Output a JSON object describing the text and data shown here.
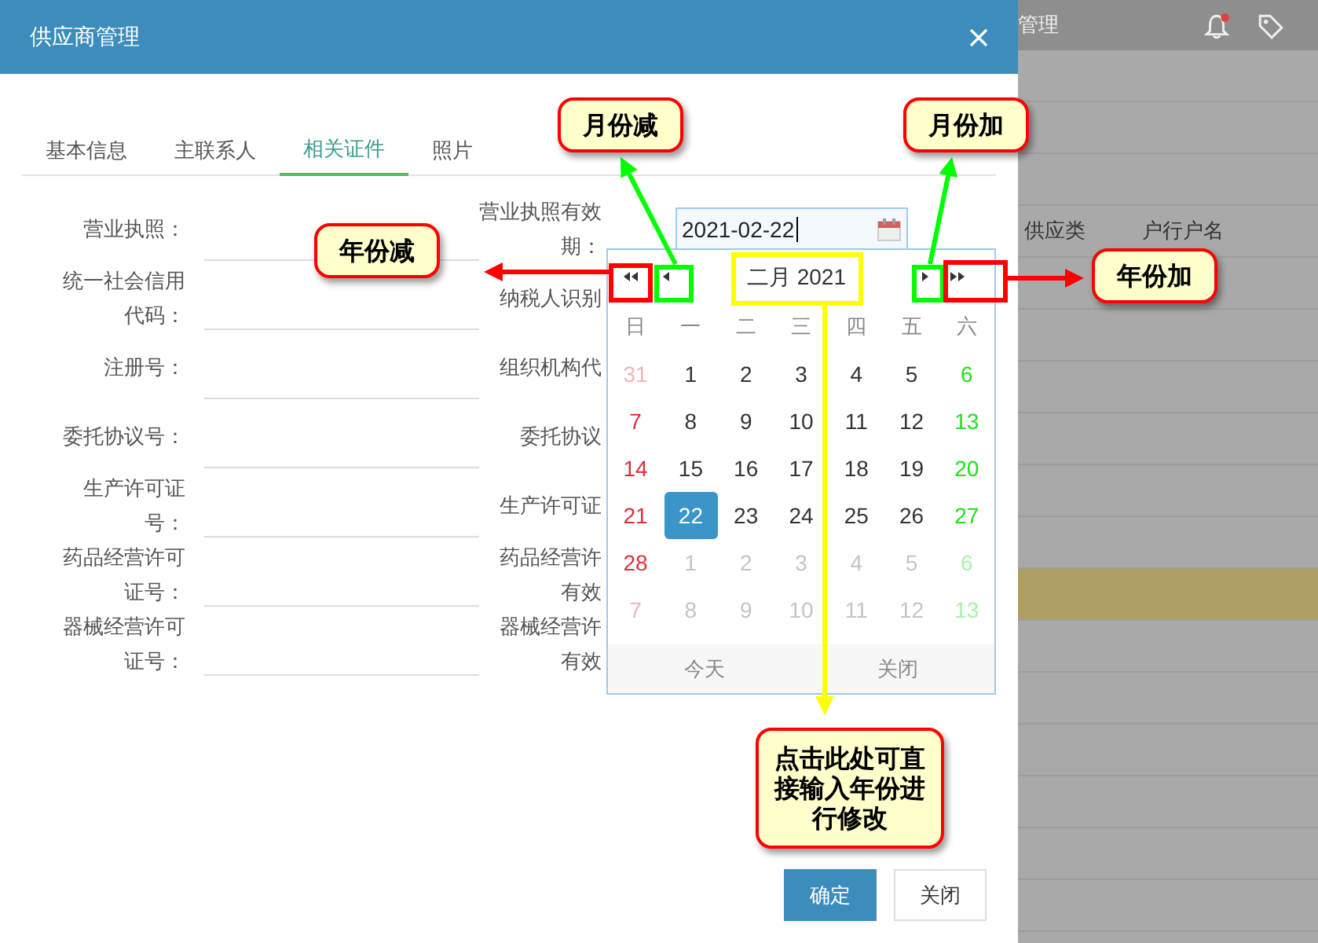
{
  "background": {
    "title": "管理",
    "columns": [
      "供应类",
      "户行户名"
    ]
  },
  "modal": {
    "title": "供应商管理",
    "tabs": [
      {
        "label": "基本信息",
        "selected": false
      },
      {
        "label": "主联系人",
        "selected": false
      },
      {
        "label": "相关证件",
        "selected": true
      },
      {
        "label": "照片",
        "selected": false
      }
    ],
    "left_fields": [
      {
        "label_lines": [
          "营业执照："
        ]
      },
      {
        "label_lines": [
          "统一社会信用",
          "代码："
        ]
      },
      {
        "label_lines": [
          "注册号："
        ]
      },
      {
        "label_lines": [
          "委托协议号："
        ]
      },
      {
        "label_lines": [
          "生产许可证",
          "号："
        ]
      },
      {
        "label_lines": [
          "药品经营许可",
          "证号："
        ]
      },
      {
        "label_lines": [
          "器械经营许可",
          "证号："
        ]
      }
    ],
    "right_fields": [
      {
        "label_lines": [
          "营业执照有效",
          "期："
        ],
        "value": "2021-02-22"
      },
      {
        "label_lines": [
          "纳税人识别"
        ]
      },
      {
        "label_lines": [
          "组织机构代"
        ]
      },
      {
        "label_lines": [
          "委托协议"
        ]
      },
      {
        "label_lines": [
          "生产许可证"
        ]
      },
      {
        "label_lines": [
          "药品经营许",
          "有效"
        ]
      },
      {
        "label_lines": [
          "器械经营许",
          "有效"
        ]
      }
    ],
    "buttons": [
      {
        "label": "确定",
        "kind": "primary"
      },
      {
        "label": "关闭",
        "kind": "default"
      }
    ]
  },
  "datepicker": {
    "title": "二月 2021",
    "weekdays": [
      "日",
      "一",
      "二",
      "三",
      "四",
      "五",
      "六"
    ],
    "days": [
      {
        "text": "31",
        "in_month": false,
        "selected": false
      },
      {
        "text": "1",
        "in_month": true,
        "selected": false
      },
      {
        "text": "2",
        "in_month": true,
        "selected": false
      },
      {
        "text": "3",
        "in_month": true,
        "selected": false
      },
      {
        "text": "4",
        "in_month": true,
        "selected": false
      },
      {
        "text": "5",
        "in_month": true,
        "selected": false
      },
      {
        "text": "6",
        "in_month": true,
        "selected": false
      },
      {
        "text": "7",
        "in_month": true,
        "selected": false
      },
      {
        "text": "8",
        "in_month": true,
        "selected": false
      },
      {
        "text": "9",
        "in_month": true,
        "selected": false
      },
      {
        "text": "10",
        "in_month": true,
        "selected": false
      },
      {
        "text": "11",
        "in_month": true,
        "selected": false
      },
      {
        "text": "12",
        "in_month": true,
        "selected": false
      },
      {
        "text": "13",
        "in_month": true,
        "selected": false
      },
      {
        "text": "14",
        "in_month": true,
        "selected": false
      },
      {
        "text": "15",
        "in_month": true,
        "selected": false
      },
      {
        "text": "16",
        "in_month": true,
        "selected": false
      },
      {
        "text": "17",
        "in_month": true,
        "selected": false
      },
      {
        "text": "18",
        "in_month": true,
        "selected": false
      },
      {
        "text": "19",
        "in_month": true,
        "selected": false
      },
      {
        "text": "20",
        "in_month": true,
        "selected": false
      },
      {
        "text": "21",
        "in_month": true,
        "selected": false
      },
      {
        "text": "22",
        "in_month": true,
        "selected": true
      },
      {
        "text": "23",
        "in_month": true,
        "selected": false
      },
      {
        "text": "24",
        "in_month": true,
        "selected": false
      },
      {
        "text": "25",
        "in_month": true,
        "selected": false
      },
      {
        "text": "26",
        "in_month": true,
        "selected": false
      },
      {
        "text": "27",
        "in_month": true,
        "selected": false
      },
      {
        "text": "28",
        "in_month": true,
        "selected": false
      },
      {
        "text": "1",
        "in_month": false,
        "selected": false
      },
      {
        "text": "2",
        "in_month": false,
        "selected": false
      },
      {
        "text": "3",
        "in_month": false,
        "selected": false
      },
      {
        "text": "4",
        "in_month": false,
        "selected": false
      },
      {
        "text": "5",
        "in_month": false,
        "selected": false
      },
      {
        "text": "6",
        "in_month": false,
        "selected": false
      },
      {
        "text": "7",
        "in_month": false,
        "selected": false
      },
      {
        "text": "8",
        "in_month": false,
        "selected": false
      },
      {
        "text": "9",
        "in_month": false,
        "selected": false
      },
      {
        "text": "10",
        "in_month": false,
        "selected": false
      },
      {
        "text": "11",
        "in_month": false,
        "selected": false
      },
      {
        "text": "12",
        "in_month": false,
        "selected": false
      },
      {
        "text": "13",
        "in_month": false,
        "selected": false
      }
    ],
    "today": "今天",
    "close": "关闭"
  },
  "annotations": [
    {
      "text": "月份减",
      "color": "#00ff00"
    },
    {
      "text": "年份减",
      "color": "#ff0000"
    },
    {
      "text": "月份加",
      "color": "#00ff00"
    },
    {
      "text": "年份加",
      "color": "#ff0000"
    },
    {
      "text": "点击此处可直接输入年份进行修改",
      "color": "#ffff00"
    }
  ]
}
